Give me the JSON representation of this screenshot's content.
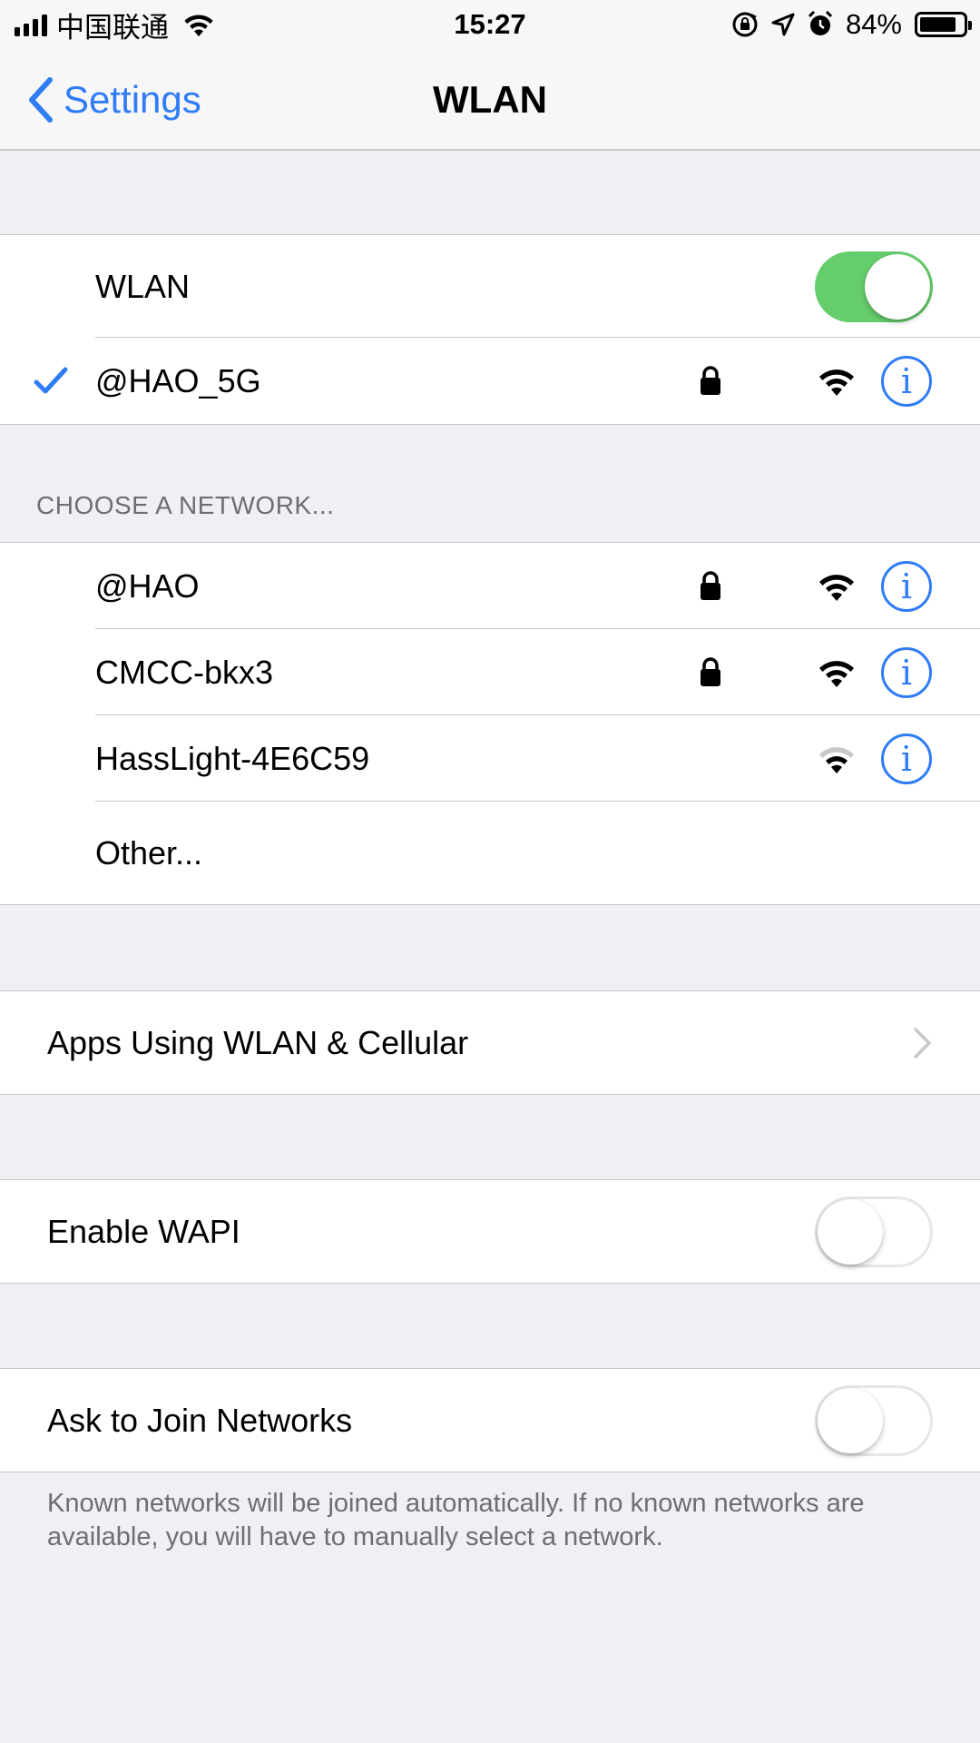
{
  "status_bar": {
    "carrier": "中国联通",
    "time": "15:27",
    "battery_percent": "84%",
    "battery_level": 0.84,
    "icons": [
      "signal-icon",
      "wifi-status-icon",
      "orientation-lock-icon",
      "location-icon",
      "alarm-icon",
      "battery-icon"
    ]
  },
  "nav": {
    "back_label": "Settings",
    "title": "WLAN"
  },
  "wlan": {
    "label": "WLAN",
    "enabled": true,
    "connected_network": "@HAO_5G",
    "connected_locked": true
  },
  "choose_network": {
    "header": "CHOOSE A NETWORK...",
    "networks": [
      {
        "name": "@HAO",
        "locked": true,
        "signal": "full"
      },
      {
        "name": "CMCC-bkx3",
        "locked": true,
        "signal": "full"
      },
      {
        "name": "HassLight-4E6C59",
        "locked": false,
        "signal": "medium"
      }
    ],
    "other_label": "Other..."
  },
  "apps_using": {
    "label": "Apps Using WLAN & Cellular"
  },
  "wapi": {
    "label": "Enable WAPI",
    "enabled": false
  },
  "ask_join": {
    "label": "Ask to Join Networks",
    "enabled": false,
    "footer": "Known networks will be joined automatically. If no known networks are available, you will have to manually select a network."
  },
  "colors": {
    "accent": "#2f7cf6",
    "toggle_on": "#65cd6b",
    "background": "#efeff4",
    "separator": "#c8c7cc",
    "secondary_text": "#6d6d72"
  }
}
